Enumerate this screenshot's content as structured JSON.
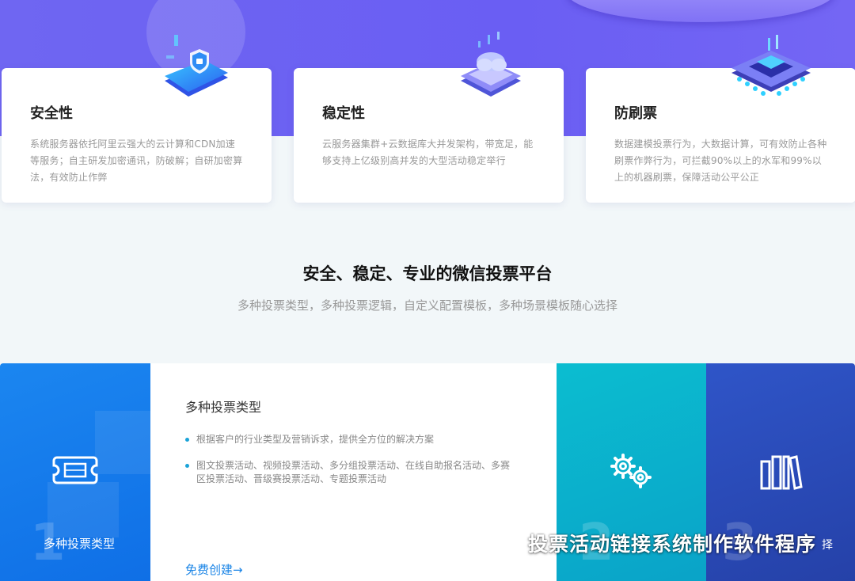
{
  "features": [
    {
      "title": "安全性",
      "desc": "系统服务器依托阿里云强大的云计算和CDN加速等服务；自主研发加密通讯，防破解；自研加密算法，有效防止作弊",
      "icon": "security-shield-phone-icon"
    },
    {
      "title": "稳定性",
      "desc": "云服务器集群+云数据库大并发架构，带宽足，能够支持上亿级别高并发的大型活动稳定举行",
      "icon": "cloud-server-icon"
    },
    {
      "title": "防刷票",
      "desc": "数据建模投票行为，大数据计算，可有效防止各种刷票作弊行为，可拦截90%以上的水军和99%以上的机器刷票，保障活动公平公正",
      "icon": "ai-chip-icon"
    }
  ],
  "section": {
    "title": "安全、稳定、专业的微信投票平台",
    "subtitle": "多种投票类型，多种投票逻辑，自定义配置模板，多种场景模板随心选择"
  },
  "types": {
    "tab1": {
      "number": "1",
      "label": "多种投票类型",
      "icon": "film-ticket-icon"
    },
    "content": {
      "title": "多种投票类型",
      "bullets": [
        "根据客户的行业类型及营销诉求，提供全方位的解决方案",
        "图文投票活动、视频投票活动、多分组投票活动、在线自助报名活动、多赛区投票活动、晋级赛投票活动、专题投票活动"
      ],
      "cta": "免费创建→"
    },
    "tab3": {
      "number": "2",
      "icon": "gears-icon"
    },
    "tab4": {
      "number": "3",
      "label_partial": "择",
      "icon": "books-icon"
    }
  },
  "watermark": {
    "text": "投票活动链接系统制作软件程序",
    "icon": "wechat-icon"
  },
  "colors": {
    "hero": "#6f66f2",
    "tab1": "#1b86f0",
    "tab3": "#0bbdd0",
    "tab4": "#2f55c8",
    "accent": "#1a84e6"
  }
}
